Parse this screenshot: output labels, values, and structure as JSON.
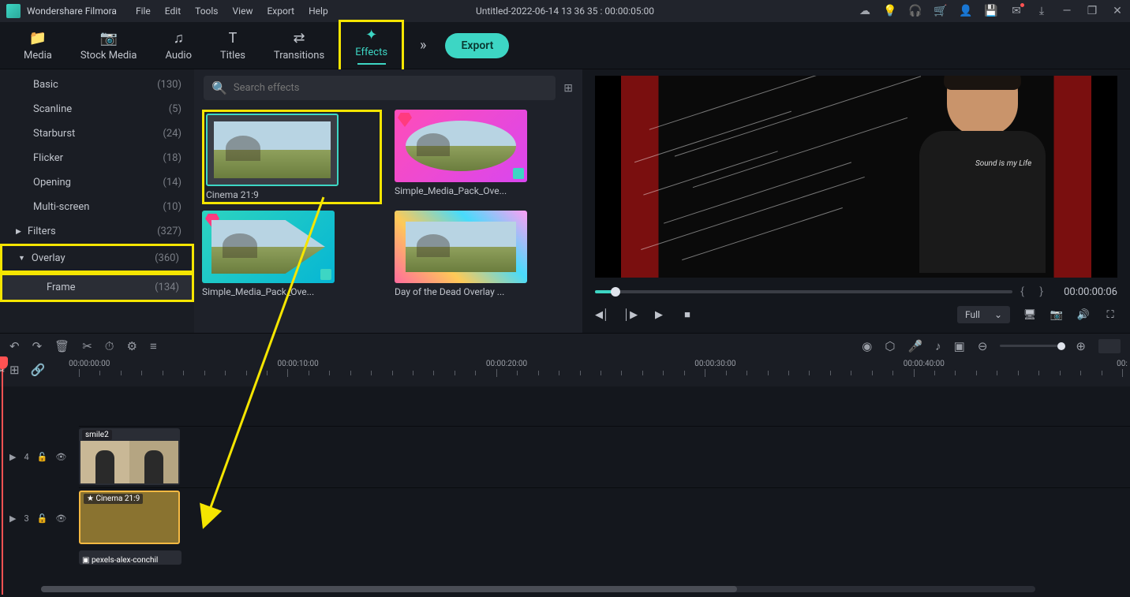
{
  "app": {
    "name": "Wondershare Filmora",
    "document": "Untitled-2022-06-14 13 36 35 : 00:00:05:00"
  },
  "menu": {
    "file": "File",
    "edit": "Edit",
    "tools": "Tools",
    "view": "View",
    "export": "Export",
    "help": "Help"
  },
  "tabs": {
    "media": "Media",
    "stock": "Stock Media",
    "audio": "Audio",
    "titles": "Titles",
    "transitions": "Transitions",
    "effects": "Effects"
  },
  "export_btn": "Export",
  "sidebar": {
    "basic": {
      "label": "Basic",
      "count": "(130)"
    },
    "scanline": {
      "label": "Scanline",
      "count": "(5)"
    },
    "starburst": {
      "label": "Starburst",
      "count": "(24)"
    },
    "flicker": {
      "label": "Flicker",
      "count": "(18)"
    },
    "opening": {
      "label": "Opening",
      "count": "(14)"
    },
    "multiscreen": {
      "label": "Multi-screen",
      "count": "(10)"
    },
    "filters": {
      "label": "Filters",
      "count": "(327)"
    },
    "overlay": {
      "label": "Overlay",
      "count": "(360)"
    },
    "frame": {
      "label": "Frame",
      "count": "(134)"
    }
  },
  "search": {
    "placeholder": "Search effects"
  },
  "effects": {
    "e0": "Cinema 21:9",
    "e1": "Simple_Media_Pack_Ove...",
    "e2": "Simple_Media_Pack_Ove...",
    "e3": "Day of the Dead Overlay ..."
  },
  "preview": {
    "timecode": "00:00:00:06",
    "quality": "Full",
    "sound_text": "Sound is\nmy\nLife"
  },
  "ruler": {
    "t0": "00:00:00:00",
    "t10": "00:00:10:00",
    "t20": "00:00:20:00",
    "t30": "00:00:30:00",
    "t40": "00:00:40:00",
    "t50": "00:"
  },
  "tracks": {
    "t4": "4",
    "t3": "3",
    "clip_video": "smile2",
    "clip_effect": "Cinema 21:9",
    "clip_audio": "pexels-alex-conchil"
  }
}
